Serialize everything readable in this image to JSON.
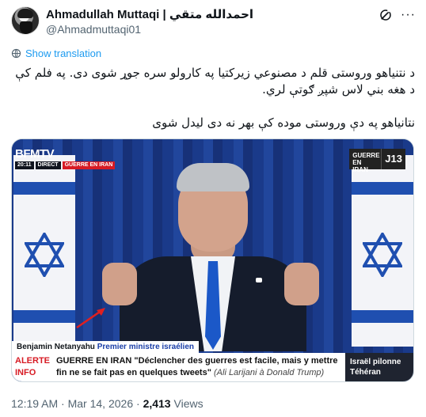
{
  "header": {
    "display_name": "Ahmadullah Muttaqi | احمدالله متقي",
    "handle": "@Ahmadmuttaqi01",
    "grok_icon": "grok-icon",
    "more_icon": "more-horizontal-icon",
    "more_glyph": "···"
  },
  "translate": {
    "label": "Show translation",
    "icon": "globe-icon"
  },
  "tweet": {
    "paragraph1": "د نتنیاهو وروستی قلم د مصنوعي زیرکتیا په کارولو سره جوړ شوی دی. په فلم کې د هغه بني لاس شپږ ګوتې لري.",
    "paragraph2": "نتانیاهو په دې وروستی موده کې بهر نه دی لیدل شوی"
  },
  "media": {
    "channel_logo": "BFMTV",
    "time": "20:11",
    "direct": "DIRECT",
    "topic_tag": "GUERRE EN IRAN",
    "channel_tag": "GUERRE EN IRAN",
    "channel_number": "J13",
    "speaker_name": "Benjamin Netanyahu",
    "speaker_role": "Premier ministre israélien",
    "alert_line1": "ALERTE",
    "alert_line2": "INFO",
    "ticker_topic": "GUERRE EN IRAN",
    "ticker_quote": "\"Déclencher des guerres est facile, mais y mettre fin ne se fait pas en quelques tweets\"",
    "ticker_attribution": "(Ali Larijani à Donald Trump)",
    "side_line1": "Israël pilonne",
    "side_line2": "Téhéran",
    "colors": {
      "bfm_red": "#d71b24",
      "flag_blue": "#1f4fb0",
      "curtain_blue": "#1c3d8f"
    }
  },
  "meta": {
    "time": "12:19 AM",
    "sep1": "·",
    "date": "Mar 14, 2026",
    "sep2": "·",
    "views_count": "2,413",
    "views_label": "Views"
  }
}
